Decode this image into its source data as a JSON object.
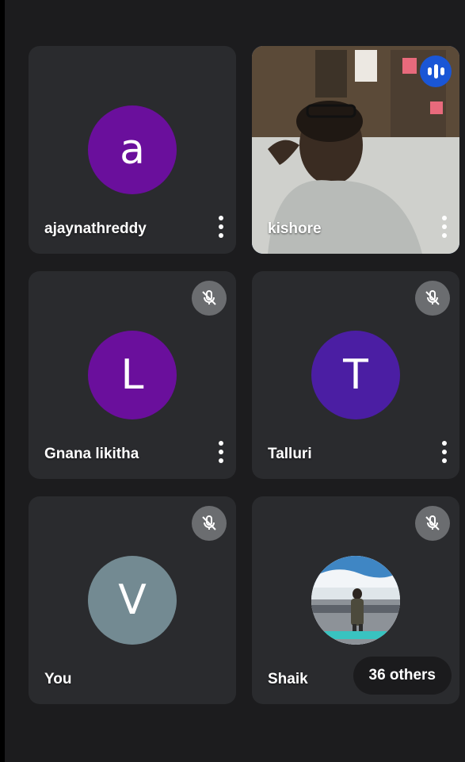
{
  "participants": [
    {
      "name": "ajaynathreddy",
      "initial": "a",
      "avatar_color": "#6a0f9c",
      "muted": false
    },
    {
      "name": "kishore",
      "initial": "",
      "avatar_color": "",
      "muted": false,
      "speaking": true,
      "has_video": true
    },
    {
      "name": "Gnana likitha",
      "initial": "L",
      "avatar_color": "#6a0f9c",
      "muted": true
    },
    {
      "name": "Talluri",
      "initial": "T",
      "avatar_color": "#4b1ea3",
      "muted": true
    },
    {
      "name": "You",
      "initial": "V",
      "avatar_color": "#738a92",
      "muted": true
    },
    {
      "name": "Shaik",
      "initial": "",
      "avatar_color": "",
      "muted": true,
      "photo": true
    }
  ],
  "others_label": "36 others",
  "colors": {
    "background": "#1c1c1e",
    "tile": "#2a2b2e",
    "active_border": "#5a8ee6",
    "speaking": "#1a56d6",
    "mute_bg": "#6b6d70"
  },
  "icons": {
    "mute": "mic-off-icon",
    "speaking": "audio-bars-icon",
    "more": "more-vert-icon"
  }
}
